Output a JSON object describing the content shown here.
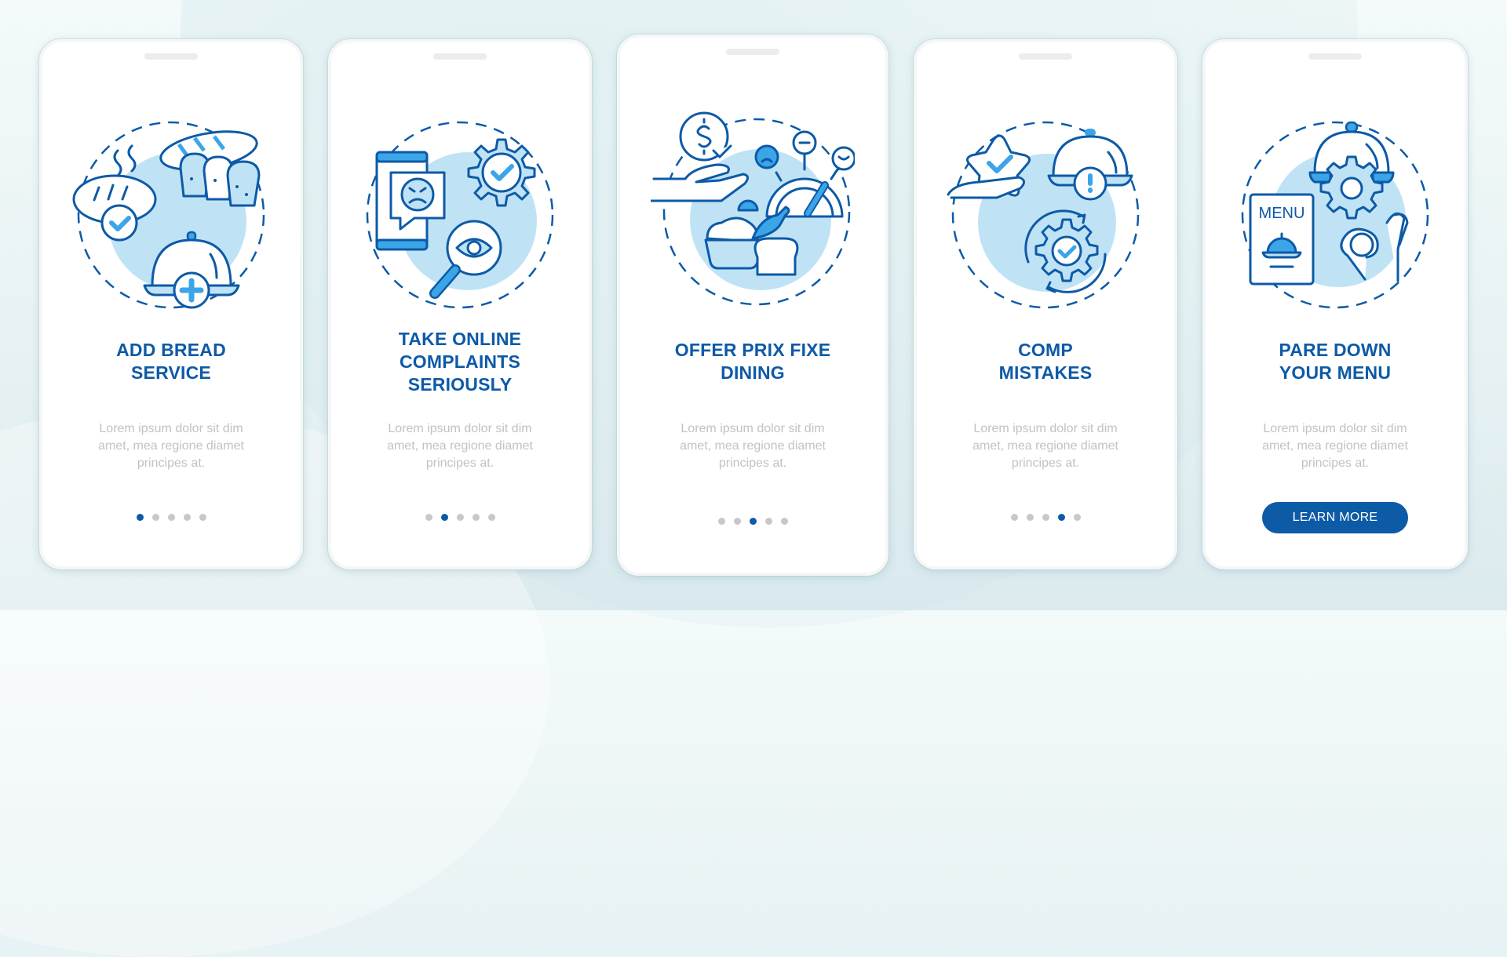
{
  "colors": {
    "accent": "#0d5aa7",
    "illustration_fill": "#bfe3f5",
    "illustration_highlight": "#3ba5e8",
    "description_text": "#c2c2c2",
    "dot_inactive": "#c8c8c8"
  },
  "screens": [
    {
      "title": "ADD BREAD\nSERVICE",
      "description": "Lorem ipsum dolor sit dim\namet, mea regione diamet\nprincipes at.",
      "illustration": "bread-service-illustration",
      "pagination": {
        "total": 5,
        "active": 1
      }
    },
    {
      "title": "TAKE ONLINE\nCOMPLAINTS\nSERIOUSLY",
      "description": "Lorem ipsum dolor sit dim\namet, mea regione diamet\nprincipes at.",
      "illustration": "online-complaints-illustration",
      "pagination": {
        "total": 5,
        "active": 2
      }
    },
    {
      "title": "OFFER PRIX FIXE\nDINING",
      "description": "Lorem ipsum dolor sit dim\namet, mea regione diamet\nprincipes at.",
      "illustration": "prix-fixe-dining-illustration",
      "pagination": {
        "total": 5,
        "active": 3
      }
    },
    {
      "title": "COMP\nMISTAKES",
      "description": "Lorem ipsum dolor sit dim\namet, mea regione diamet\nprincipes at.",
      "illustration": "comp-mistakes-illustration",
      "pagination": {
        "total": 5,
        "active": 4
      }
    },
    {
      "title": "PARE DOWN\nYOUR MENU",
      "description": "Lorem ipsum dolor sit dim\namet, mea regione diamet\nprincipes at.",
      "illustration": "pare-down-menu-illustration",
      "menu_label": "MENU",
      "button_label": "LEARN MORE"
    }
  ]
}
